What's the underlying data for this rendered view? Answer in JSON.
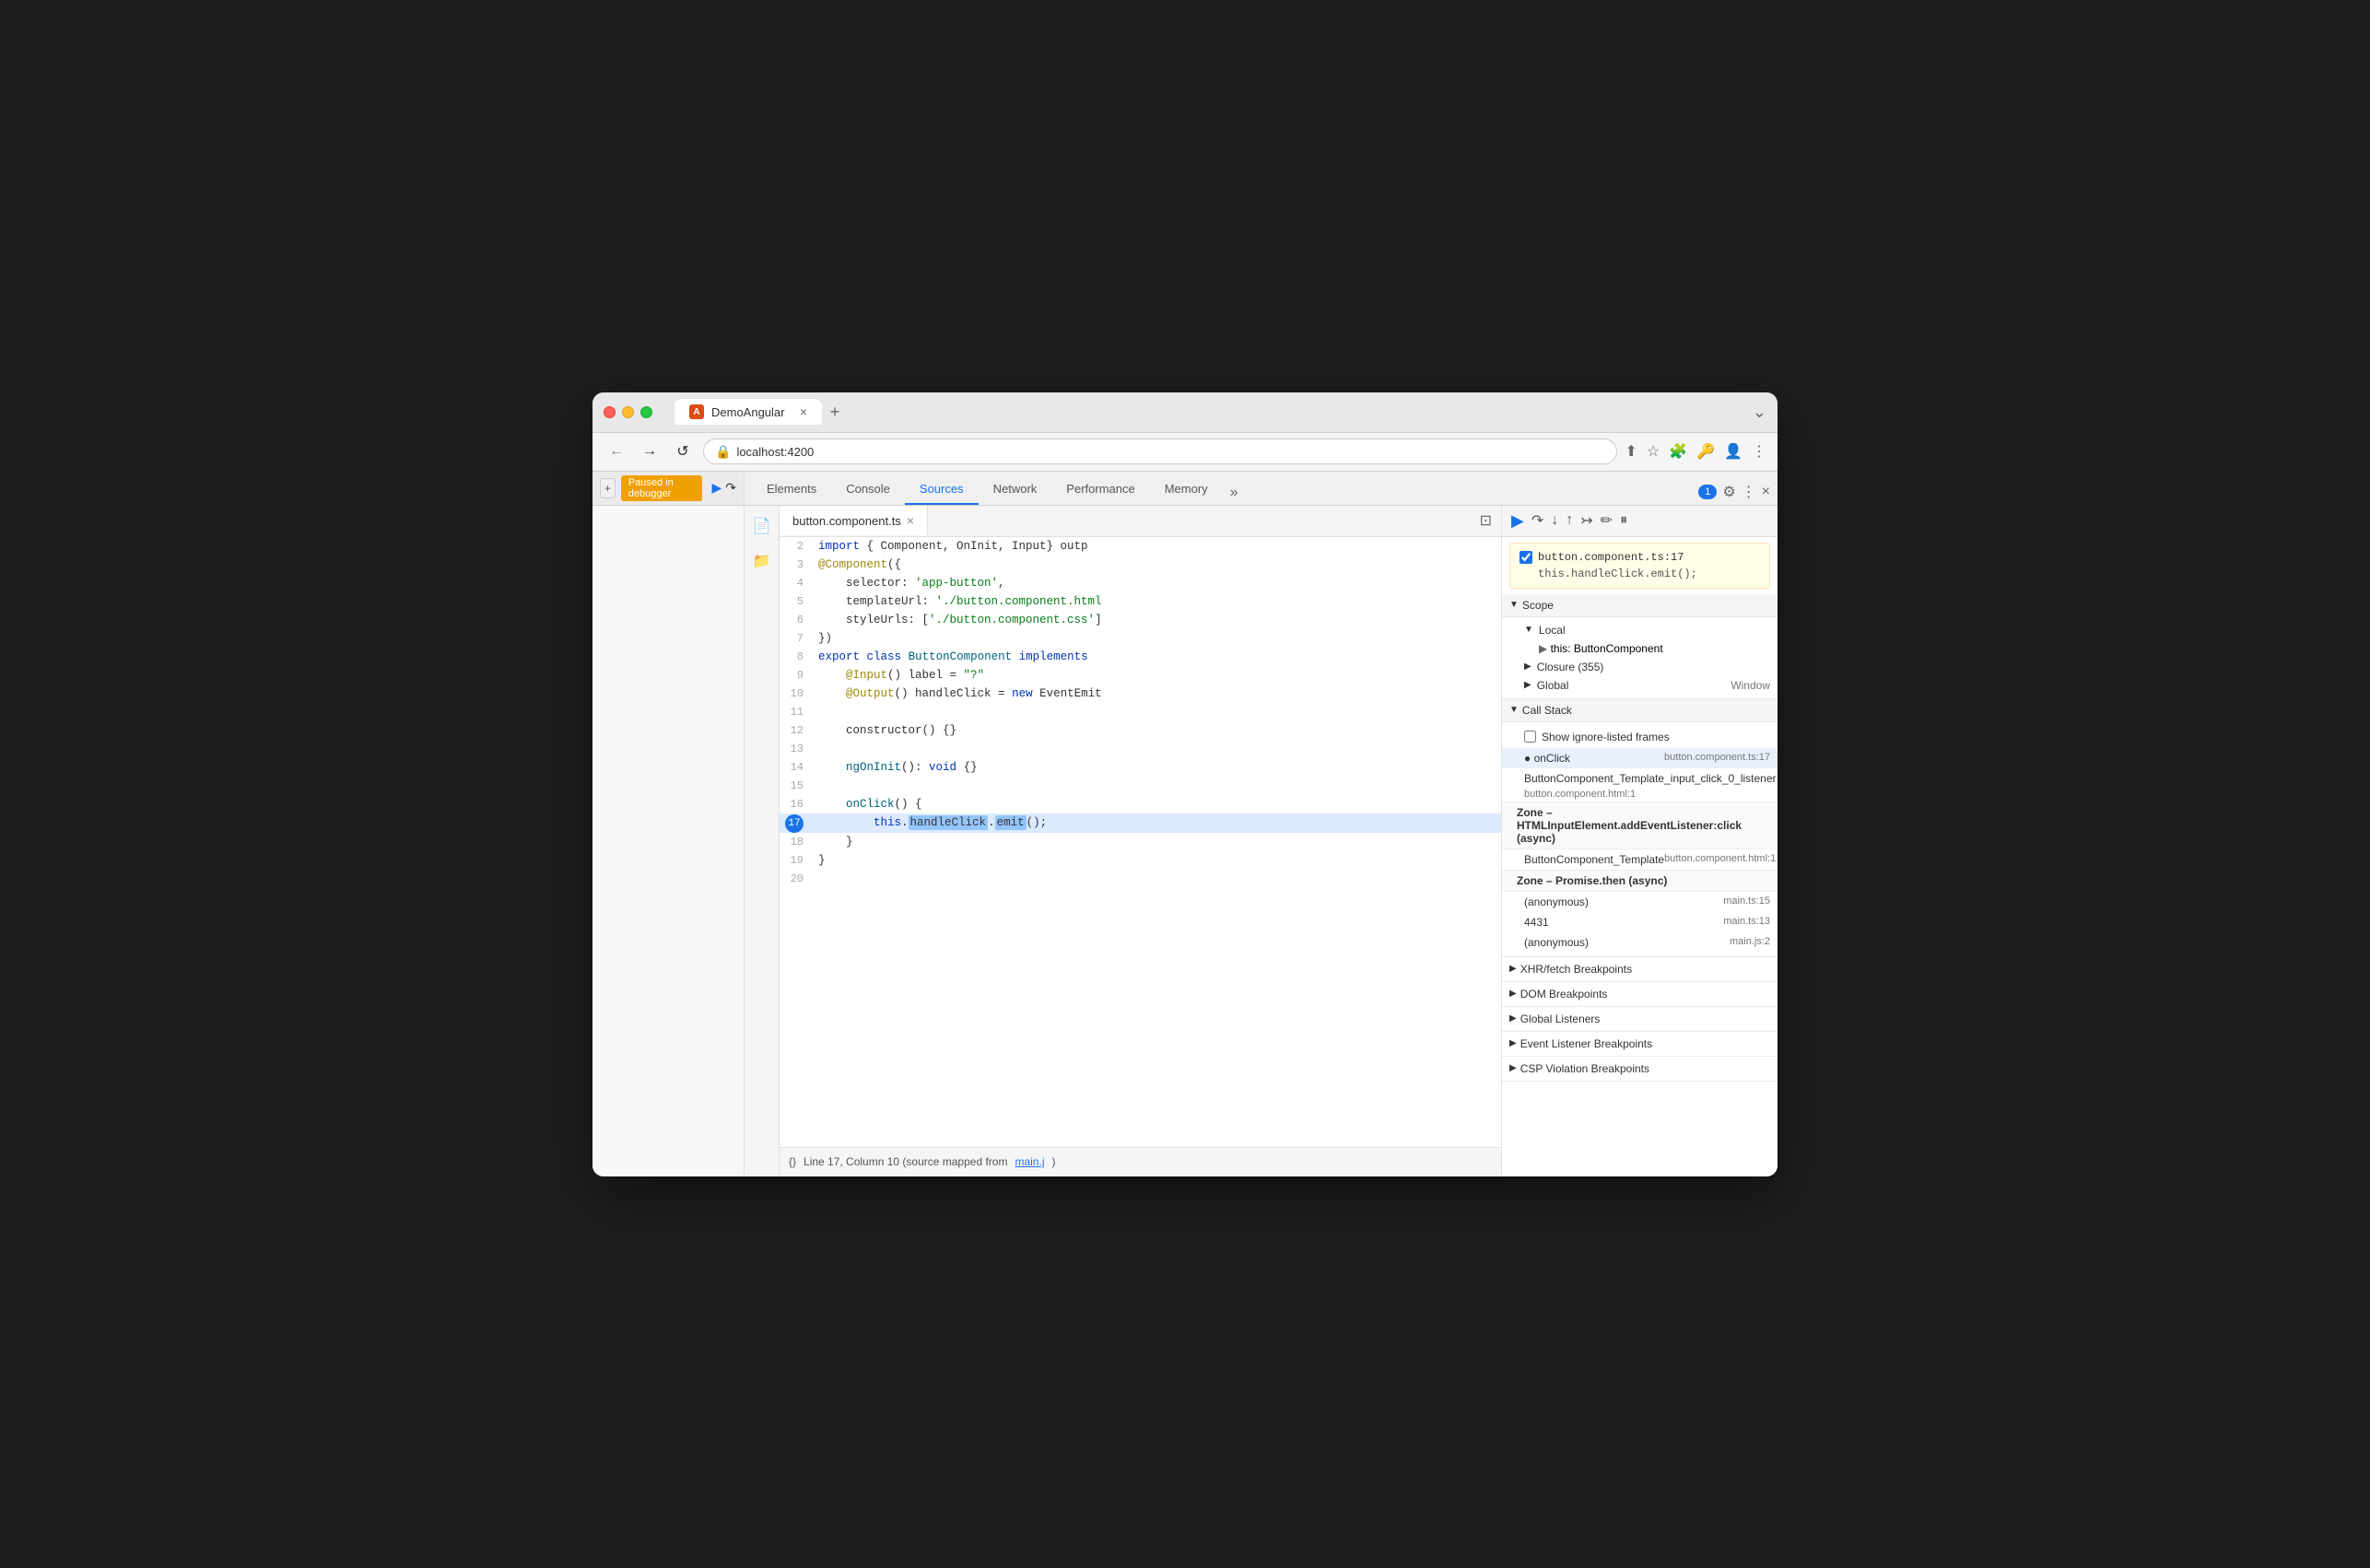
{
  "browser": {
    "tab_title": "DemoAngular",
    "tab_icon": "A",
    "address": "localhost:4200",
    "close_tab": "×",
    "new_tab": "+"
  },
  "devtools": {
    "tabs": [
      {
        "label": "Elements",
        "active": false
      },
      {
        "label": "Console",
        "active": false
      },
      {
        "label": "Sources",
        "active": true
      },
      {
        "label": "Network",
        "active": false
      },
      {
        "label": "Performance",
        "active": false
      },
      {
        "label": "Memory",
        "active": false
      }
    ],
    "right_controls": {
      "badge": "1",
      "settings_label": "⚙",
      "more_label": "⋮",
      "close_label": "×"
    }
  },
  "left_panel": {
    "paused_label": "Paused in debugger"
  },
  "sources": {
    "file_tab": "button.component.ts"
  },
  "code": {
    "lines": [
      {
        "num": 2,
        "content": "import { Component, OnInit, Input } outp"
      },
      {
        "num": 3,
        "content": "@Component({"
      },
      {
        "num": 4,
        "content": "    selector: 'app-button',"
      },
      {
        "num": 5,
        "content": "    templateUrl: './button.component.html"
      },
      {
        "num": 6,
        "content": "    styleUrls: ['./button.component.css']"
      },
      {
        "num": 7,
        "content": "})"
      },
      {
        "num": 8,
        "content": "export class ButtonComponent implements"
      },
      {
        "num": 9,
        "content": "    @Input() label = \"?\""
      },
      {
        "num": 10,
        "content": "    @Output() handleClick = new EventEmit"
      },
      {
        "num": 11,
        "content": ""
      },
      {
        "num": 12,
        "content": "    constructor() {}"
      },
      {
        "num": 13,
        "content": ""
      },
      {
        "num": 14,
        "content": "    ngOnInit(): void {}"
      },
      {
        "num": 15,
        "content": ""
      },
      {
        "num": 16,
        "content": "    onClick() {"
      },
      {
        "num": 17,
        "content": "        this.handleClick.emit();",
        "highlighted": true
      },
      {
        "num": 18,
        "content": "    }"
      },
      {
        "num": 19,
        "content": "}"
      },
      {
        "num": 20,
        "content": ""
      }
    ],
    "footer_text": "Line 17, Column 10 (source mapped from ",
    "footer_link": "main.j"
  },
  "debugger": {
    "breakpoint_file": "button.component.ts:17",
    "breakpoint_code": "this.handleClick.emit();",
    "scope_label": "Scope",
    "local_label": "Local",
    "local_item": "this: ButtonComponent",
    "closure_label": "Closure (355)",
    "global_label": "Global",
    "global_value": "Window",
    "call_stack_label": "Call Stack",
    "show_ignore_label": "Show ignore-listed frames",
    "call_stack_items": [
      {
        "name": "onClick",
        "source": "button.component.ts:17",
        "active": true
      },
      {
        "name": "ButtonComponent_Template_input_click_0_listener",
        "source": "button.component.html:1",
        "active": false
      }
    ],
    "zone1_label": "Zone – HTMLInputElement.addEventListener:click (async)",
    "zone1_items": [
      {
        "name": "ButtonComponent_Template",
        "source": "button.component.html:1"
      }
    ],
    "zone2_label": "Zone – Promise.then (async)",
    "zone2_items": [
      {
        "name": "(anonymous)",
        "source": "main.ts:15"
      },
      {
        "name": "4431",
        "source": "main.ts:13"
      },
      {
        "name": "(anonymous)",
        "source": "main.js:2"
      }
    ],
    "xhr_label": "XHR/fetch Breakpoints",
    "dom_label": "DOM Breakpoints",
    "global_listeners_label": "Global Listeners",
    "event_listener_label": "Event Listener Breakpoints",
    "csp_label": "CSP Violation Breakpoints"
  }
}
